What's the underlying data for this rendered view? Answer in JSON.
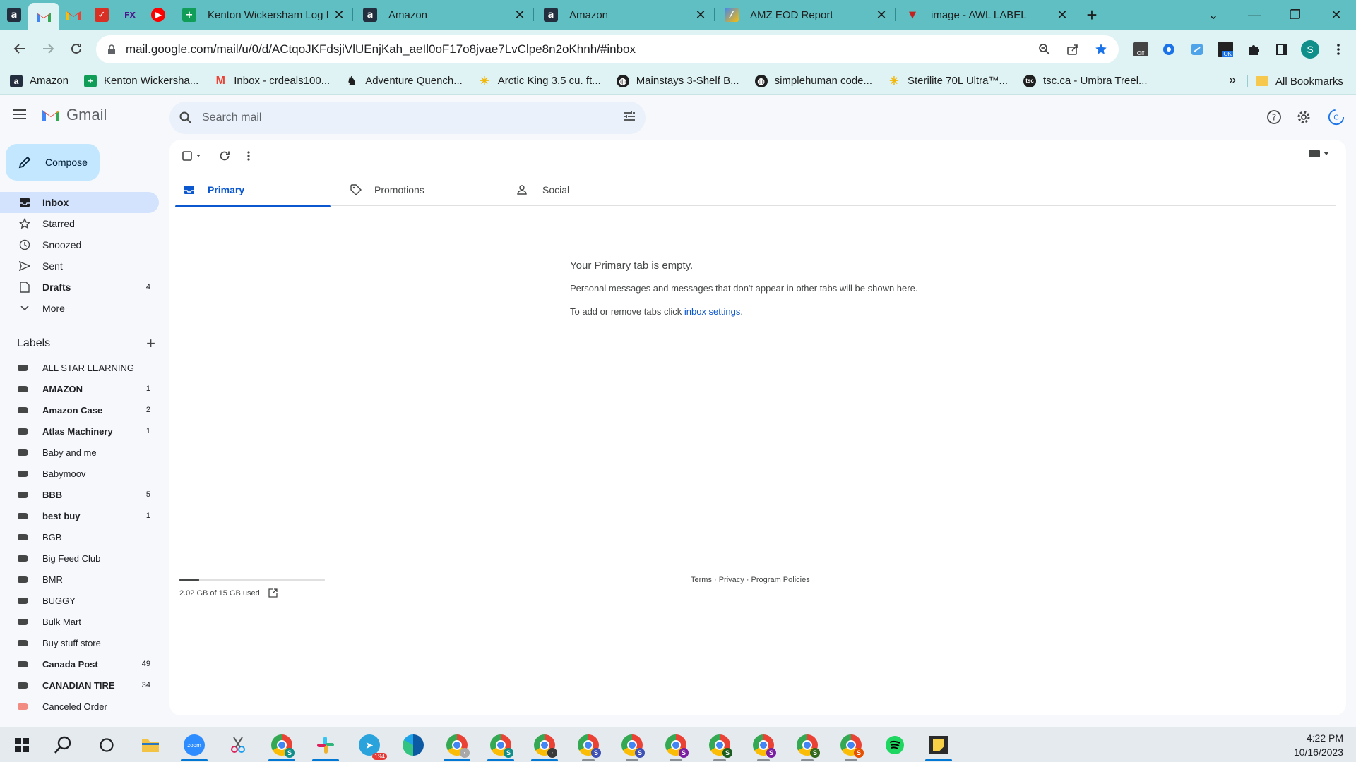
{
  "browser": {
    "tabs": [
      {
        "title": "Kenton Wickersham Log f"
      },
      {
        "title": "Amazon"
      },
      {
        "title": "Amazon"
      },
      {
        "title": "AMZ EOD Report"
      },
      {
        "title": "image - AWL LABEL"
      }
    ],
    "url": "mail.google.com/mail/u/0/d/ACtqoJKFdsjiVlUEnjKah_aeIl0oF17o8jvae7LvClpe8n2oKhnh/#inbox",
    "profile_initial": "S",
    "bookmarks": [
      {
        "label": "Amazon",
        "icon": "amazon-icon",
        "color": "#232f3e"
      },
      {
        "label": "Kenton Wickersha...",
        "icon": "sheets-icon",
        "color": "#0f9d58"
      },
      {
        "label": "Inbox - crdeals100...",
        "icon": "gmail-icon",
        "color": "#ea4335"
      },
      {
        "label": "Adventure Quench...",
        "icon": "dog-icon",
        "color": "#1f1f1f"
      },
      {
        "label": "Arctic King 3.5 cu. ft...",
        "icon": "walmart-icon",
        "color": "#f2b705"
      },
      {
        "label": "Mainstays 3-Shelf B...",
        "icon": "globe-icon",
        "color": "#1f1f1f"
      },
      {
        "label": "simplehuman code...",
        "icon": "globe-icon",
        "color": "#1f1f1f"
      },
      {
        "label": "Sterilite 70L Ultra™...",
        "icon": "walmart-icon",
        "color": "#f2b705"
      },
      {
        "label": "tsc.ca - Umbra Treel...",
        "icon": "tsc-icon",
        "color": "#1f1f1f"
      }
    ],
    "all_bookmarks": "All Bookmarks"
  },
  "gmail": {
    "app_name": "Gmail",
    "search_placeholder": "Search mail",
    "compose_label": "Compose",
    "account_initial": "C",
    "nav": [
      {
        "label": "Inbox",
        "icon": "inbox-icon",
        "active": true,
        "bold": true,
        "count": ""
      },
      {
        "label": "Starred",
        "icon": "star-icon",
        "count": ""
      },
      {
        "label": "Snoozed",
        "icon": "clock-icon",
        "count": ""
      },
      {
        "label": "Sent",
        "icon": "send-icon",
        "count": ""
      },
      {
        "label": "Drafts",
        "icon": "draft-icon",
        "bold": true,
        "count": "4"
      },
      {
        "label": "More",
        "icon": "chevron-down-icon",
        "count": ""
      }
    ],
    "labels_title": "Labels",
    "labels": [
      {
        "name": "ALL STAR LEARNING",
        "count": "",
        "bold": false
      },
      {
        "name": "AMAZON",
        "count": "1",
        "bold": true
      },
      {
        "name": "Amazon Case",
        "count": "2",
        "bold": true
      },
      {
        "name": "Atlas Machinery",
        "count": "1",
        "bold": true
      },
      {
        "name": "Baby and me",
        "count": "",
        "bold": false
      },
      {
        "name": "Babymoov",
        "count": "",
        "bold": false
      },
      {
        "name": "BBB",
        "count": "5",
        "bold": true
      },
      {
        "name": "best buy",
        "count": "1",
        "bold": true
      },
      {
        "name": "BGB",
        "count": "",
        "bold": false
      },
      {
        "name": "Big Feed Club",
        "count": "",
        "bold": false
      },
      {
        "name": "BMR",
        "count": "",
        "bold": false
      },
      {
        "name": "BUGGY",
        "count": "",
        "bold": false
      },
      {
        "name": "Bulk Mart",
        "count": "",
        "bold": false
      },
      {
        "name": "Buy stuff store",
        "count": "",
        "bold": false
      },
      {
        "name": "Canada Post",
        "count": "49",
        "bold": true
      },
      {
        "name": "CANADIAN TIRE",
        "count": "34",
        "bold": true
      },
      {
        "name": "Canceled Order",
        "count": "",
        "bold": false,
        "color": "#f28b82"
      },
      {
        "name": "",
        "count": "",
        "bold": false
      }
    ],
    "tabs": [
      {
        "label": "Primary",
        "icon": "inbox-tab-icon",
        "active": true
      },
      {
        "label": "Promotions",
        "icon": "tag-icon"
      },
      {
        "label": "Social",
        "icon": "people-icon"
      }
    ],
    "empty": {
      "title": "Your Primary tab is empty.",
      "line1": "Personal messages and messages that don't appear in other tabs will be shown here.",
      "line2_prefix": "To add or remove tabs click ",
      "line2_link": "inbox settings",
      "line2_suffix": "."
    },
    "storage": {
      "text": "2.02 GB of 15 GB used",
      "fraction": 0.135
    },
    "footer": "Terms · Privacy · Program Policies"
  },
  "taskbar": {
    "time": "4:22 PM",
    "date": "10/16/2023",
    "telegram_badge": "194"
  }
}
